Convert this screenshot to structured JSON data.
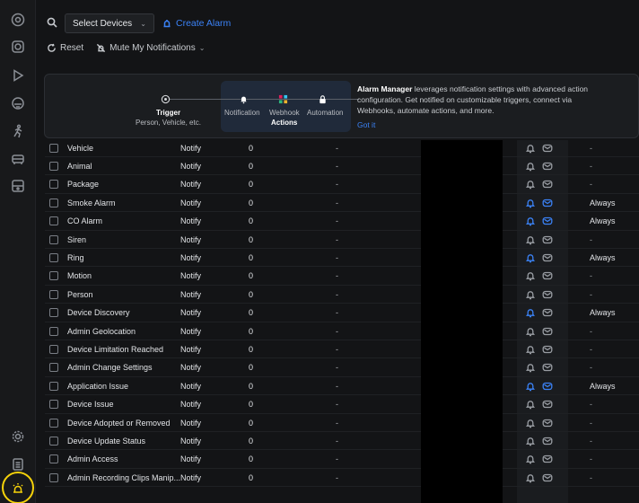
{
  "toolbar": {
    "select_label": "Select Devices",
    "create_alarm": "Create Alarm",
    "reset": "Reset",
    "mute": "Mute My Notifications"
  },
  "banner": {
    "trigger_title": "Trigger",
    "trigger_sub": "Person, Vehicle, etc.",
    "notification": "Notification",
    "webhook": "Webhook",
    "automation": "Automation",
    "actions": "Actions",
    "text_bold": "Alarm Manager",
    "text_rest": " leverages notification settings with advanced action configuration. Get notified on customizable triggers, connect via Webhooks, automate actions, and more.",
    "got_it": "Got it"
  },
  "colors": {
    "accent": "#3b82f6",
    "highlight": "#f5d20a"
  },
  "rows": [
    {
      "name": "Vehicle",
      "action": "Notify",
      "count": "0",
      "detail": "-",
      "bell_on": false,
      "mail_on": false,
      "schedule": "-"
    },
    {
      "name": "Animal",
      "action": "Notify",
      "count": "0",
      "detail": "-",
      "bell_on": false,
      "mail_on": false,
      "schedule": "-"
    },
    {
      "name": "Package",
      "action": "Notify",
      "count": "0",
      "detail": "-",
      "bell_on": false,
      "mail_on": false,
      "schedule": "-"
    },
    {
      "name": "Smoke Alarm",
      "action": "Notify",
      "count": "0",
      "detail": "-",
      "bell_on": true,
      "mail_on": true,
      "schedule": "Always"
    },
    {
      "name": "CO Alarm",
      "action": "Notify",
      "count": "0",
      "detail": "-",
      "bell_on": true,
      "mail_on": true,
      "schedule": "Always"
    },
    {
      "name": "Siren",
      "action": "Notify",
      "count": "0",
      "detail": "-",
      "bell_on": false,
      "mail_on": false,
      "schedule": "-"
    },
    {
      "name": "Ring",
      "action": "Notify",
      "count": "0",
      "detail": "-",
      "bell_on": true,
      "mail_on": false,
      "schedule": "Always"
    },
    {
      "name": "Motion",
      "action": "Notify",
      "count": "0",
      "detail": "-",
      "bell_on": false,
      "mail_on": false,
      "schedule": "-"
    },
    {
      "name": "Person",
      "action": "Notify",
      "count": "0",
      "detail": "-",
      "bell_on": false,
      "mail_on": false,
      "schedule": "-"
    },
    {
      "name": "Device Discovery",
      "action": "Notify",
      "count": "0",
      "detail": "-",
      "bell_on": true,
      "mail_on": false,
      "schedule": "Always"
    },
    {
      "name": "Admin Geolocation",
      "action": "Notify",
      "count": "0",
      "detail": "-",
      "bell_on": false,
      "mail_on": false,
      "schedule": "-"
    },
    {
      "name": "Device Limitation Reached",
      "action": "Notify",
      "count": "0",
      "detail": "-",
      "bell_on": false,
      "mail_on": false,
      "schedule": "-"
    },
    {
      "name": "Admin Change Settings",
      "action": "Notify",
      "count": "0",
      "detail": "-",
      "bell_on": false,
      "mail_on": false,
      "schedule": "-"
    },
    {
      "name": "Application Issue",
      "action": "Notify",
      "count": "0",
      "detail": "-",
      "bell_on": true,
      "mail_on": true,
      "schedule": "Always"
    },
    {
      "name": "Device Issue",
      "action": "Notify",
      "count": "0",
      "detail": "-",
      "bell_on": false,
      "mail_on": false,
      "schedule": "-"
    },
    {
      "name": "Device Adopted or Removed",
      "action": "Notify",
      "count": "0",
      "detail": "-",
      "bell_on": false,
      "mail_on": false,
      "schedule": "-"
    },
    {
      "name": "Device Update Status",
      "action": "Notify",
      "count": "0",
      "detail": "-",
      "bell_on": false,
      "mail_on": false,
      "schedule": "-"
    },
    {
      "name": "Admin Access",
      "action": "Notify",
      "count": "0",
      "detail": "-",
      "bell_on": false,
      "mail_on": false,
      "schedule": "-"
    },
    {
      "name": "Admin Recording Clips Manip...",
      "action": "Notify",
      "count": "0",
      "detail": "-",
      "bell_on": false,
      "mail_on": false,
      "schedule": "-"
    }
  ]
}
